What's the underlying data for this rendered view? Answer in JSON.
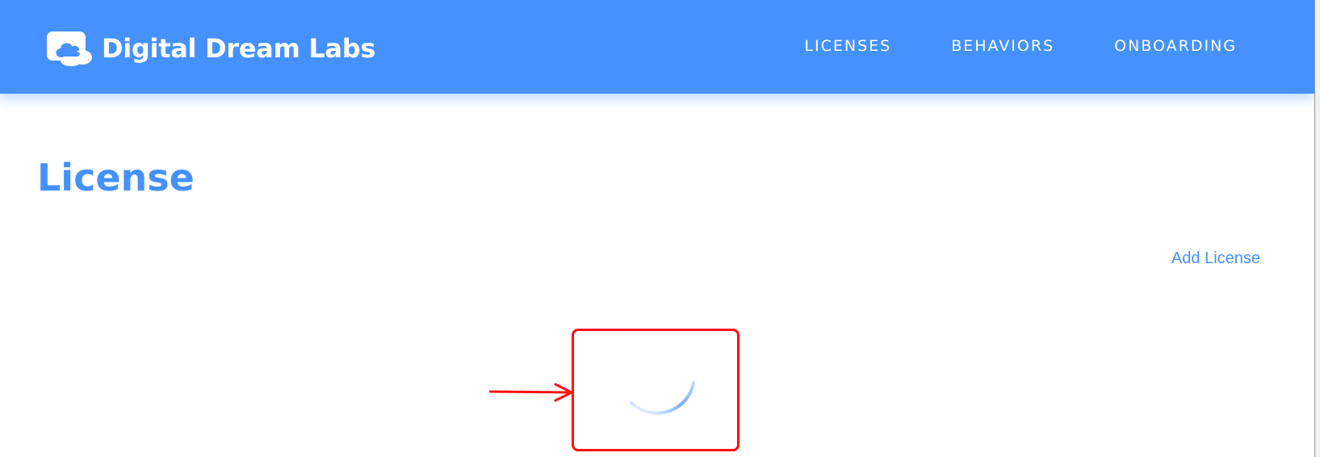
{
  "colors": {
    "brand_blue": "#4591ff",
    "white": "#ffffff",
    "annotation_red": "#ff1111"
  },
  "navbar": {
    "logo_icon": "cloud-icon",
    "brand_name": "Digital Dream Labs",
    "links": [
      {
        "label": "LICENSES"
      },
      {
        "label": "BEHAVIORS"
      },
      {
        "label": "ONBOARDING"
      }
    ]
  },
  "main": {
    "title": "License",
    "add_license_label": "Add License",
    "loading_indicator": "loading-spinner-icon"
  },
  "annotation": {
    "shape": "rounded-rectangle-with-arrow",
    "highlights": "loading-spinner-icon"
  }
}
